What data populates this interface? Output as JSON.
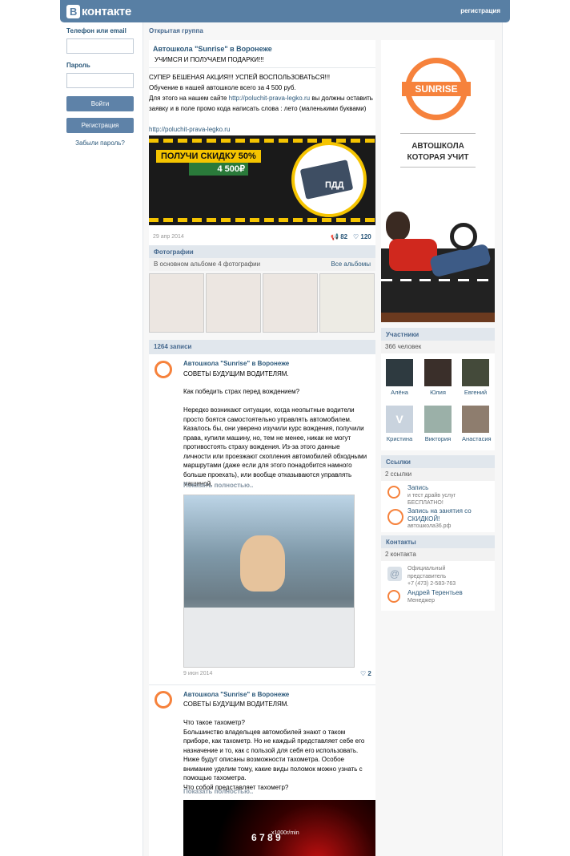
{
  "header": {
    "logo_letter": "В",
    "logo_text": "контакте",
    "register_link": "регистрация"
  },
  "login": {
    "phone_label": "Телефон или email",
    "password_label": "Пароль",
    "login_button": "Войти",
    "register_button": "Регистрация",
    "forgot_link": "Забыли пароль?"
  },
  "group": {
    "type": "Открытая группа",
    "name": "Автошкола \"Sunrise\" в Воронеже",
    "status": "УЧИМСЯ И ПОЛУЧАЕМ ПОДАРКИ!!!",
    "desc_line1": "СУПЕР БЕШЕНАЯ АКЦИЯ!!! УСПЕЙ ВОСПОЛЬЗОВАТЬСЯ!!!",
    "desc_line2": "Обучение в нашей автошколе всего за 4 500 руб.",
    "desc_line3a": "Для этого на нашем сайте ",
    "desc_link1": "http://poluchit-prava-legko.ru",
    "desc_line3b": " вы должны оставить",
    "desc_line4": "заявку и в поле промо кода написать слова : лето (маленькими буквами)",
    "desc_link2": "http://poluchit-prava-legko.ru"
  },
  "banner": {
    "headline": "ПОЛУЧИ СКИДКУ 50%",
    "price": "4 500₽",
    "badge": "ПДД"
  },
  "pinned": {
    "date": "29 апр 2014",
    "shares": "82",
    "likes": "120"
  },
  "photos": {
    "header": "Фотографии",
    "album_text": "В основном альбоме 4 фотографии",
    "all_albums": "Все альбомы"
  },
  "wall": {
    "count_header": "1264 записи"
  },
  "posts": [
    {
      "author": "Автошкола \"Sunrise\" в Воронеже",
      "title": "СОВЕТЫ БУДУЩИМ ВОДИТЕЛЯМ.",
      "lines": [
        "Как победить страх перед вождением?",
        "",
        "Нередко возникают ситуации, когда неопытные водители",
        "просто боятся самостоятельно управлять автомобилем.",
        "Казалось бы, они уверено изучили курс вождения, получили",
        "права, купили машину, но, тем не менее, никак не могут",
        "противостоять страху вождения. Из-за этого данные",
        "личности или проезжают скопления автомобилей обходными",
        "маршрутами (даже если для этого понадобится намного",
        "больше проехать), или вообще отказываются управлять",
        "машиной."
      ],
      "more": "Показать полностью..",
      "date": "9 июн 2014",
      "likes": "2"
    },
    {
      "author": "Автошкола \"Sunrise\" в Воронеже",
      "title": "СОВЕТЫ БУДУЩИМ ВОДИТЕЛЯМ.",
      "lines": [
        "Что такое тахометр?",
        "Большинство владельцев автомобилей знают о таком",
        "приборе, как тахометр. Но не каждый представляет себе его",
        "назначение и то, как с пользой для себя его использовать.",
        "Ниже будут описаны возможности тахометра. Особое",
        "внимание уделим тому, какие виды поломок можно узнать с",
        "помощью тахометра.",
        "Что собой представляет тахометр?"
      ],
      "more": "Показать полностью..",
      "gauge_label": "x1000r/min"
    }
  ],
  "avatar_logo": {
    "brand": "SUNRISE",
    "tagline_line1": "АВТОШКОЛА",
    "tagline_line2": "КОТОРАЯ УЧИТ"
  },
  "members": {
    "header": "Участники",
    "count": "366 человек",
    "list": [
      {
        "name": "Алёна",
        "color": "#2e3a40"
      },
      {
        "name": "Юлия",
        "color": "#3a2f2a"
      },
      {
        "name": "Евгений",
        "color": "#444a3a"
      },
      {
        "name": "Кристина",
        "color": "#C9D3DE"
      },
      {
        "name": "Виктория",
        "color": "#9bb0a8"
      },
      {
        "name": "Анастасия",
        "color": "#8e7d6e"
      }
    ]
  },
  "links": {
    "header": "Ссылки",
    "count": "2 ссылки",
    "items": [
      {
        "line1": "Запись",
        "line2": "и тест драйв услуг",
        "line3": "БЕСПЛАТНО!"
      },
      {
        "line1": "Запись на занятия со",
        "line2": "СКИДКОЙ!",
        "line3": "автошкола36.рф"
      }
    ]
  },
  "contacts": {
    "header": "Контакты",
    "count": "2 контакта",
    "items": [
      {
        "line1": "Официальный",
        "line2": "представитель",
        "line3": "+7 (473) 2-583-763"
      },
      {
        "line1": "Андрей Терентьев",
        "line2": "Менеджер"
      }
    ]
  },
  "colors": {
    "header_bg": "#587FA4",
    "link": "#2B587A",
    "accent": "#F6823C",
    "section_bg": "#E1E7ED"
  }
}
